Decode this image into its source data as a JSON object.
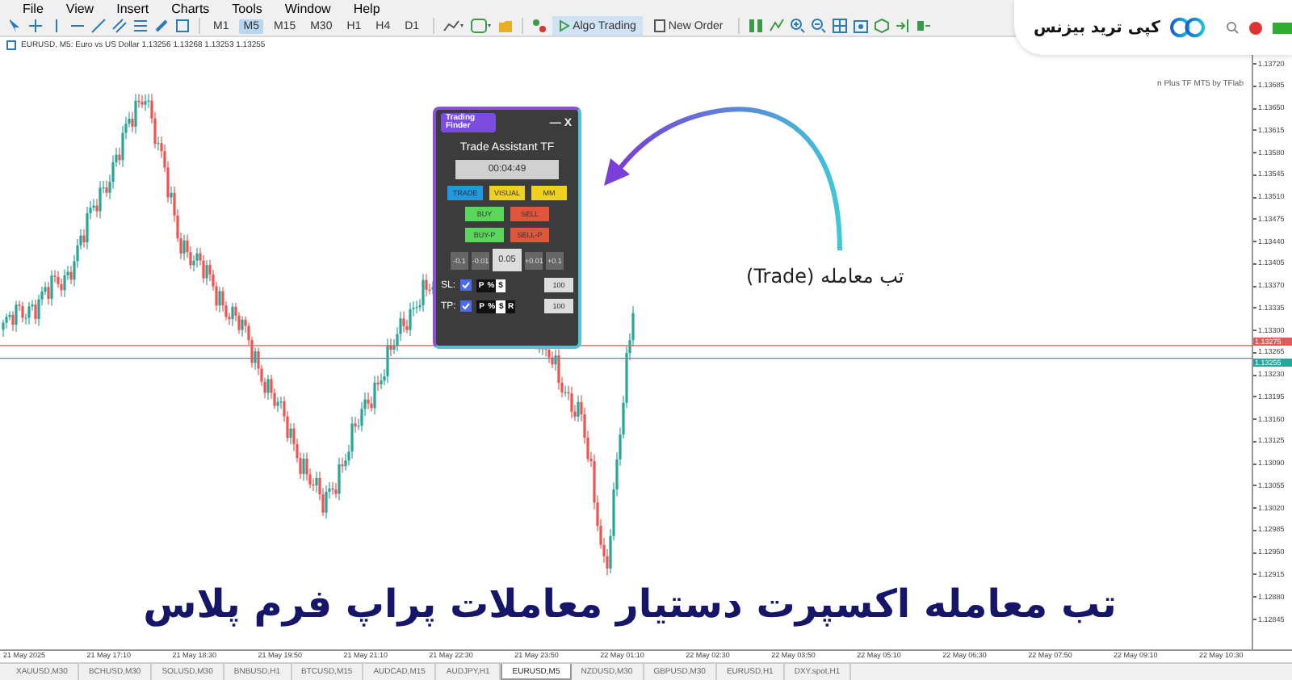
{
  "menu": [
    {
      "label": "File"
    },
    {
      "label": "View"
    },
    {
      "label": "Insert"
    },
    {
      "label": "Charts"
    },
    {
      "label": "Tools"
    },
    {
      "label": "Window"
    },
    {
      "label": "Help"
    }
  ],
  "timeframes": [
    {
      "label": "M1",
      "selected": false
    },
    {
      "label": "M5",
      "selected": true
    },
    {
      "label": "M15",
      "selected": false
    },
    {
      "label": "M30",
      "selected": false
    },
    {
      "label": "H1",
      "selected": false
    },
    {
      "label": "H4",
      "selected": false
    },
    {
      "label": "D1",
      "selected": false
    }
  ],
  "toolbar_buttons": [
    {
      "label": "Algo Trading",
      "selected": true
    },
    {
      "label": "New Order",
      "selected": false
    }
  ],
  "brand": {
    "name": "کپی ترید بیزنس"
  },
  "chart": {
    "header": "EURUSD, M5:  Euro vs US Dollar  1.13256  1.13268  1.13253  1.13255",
    "indicator_label": "n Plus TF MT5 by TFlab",
    "price_labels": [
      "1.13720",
      "1.13685",
      "1.13650",
      "1.13615",
      "1.13580",
      "1.13545",
      "1.13510",
      "1.13475",
      "1.13440",
      "1.13405",
      "1.13370",
      "1.13335",
      "1.13300",
      "1.13265",
      "1.13230",
      "1.13195",
      "1.13160",
      "1.13125",
      "1.13090",
      "1.13055",
      "1.13020",
      "1.12985",
      "1.12950",
      "1.12915",
      "1.12880",
      "1.12845"
    ],
    "price_lines": [
      {
        "price": "1.13275",
        "color": "#e05a5a"
      },
      {
        "price": "1.13255",
        "color": "#26a69a"
      }
    ],
    "time_labels": [
      "21 May 2025",
      "21 May 17:10",
      "21 May 18:30",
      "21 May 19:50",
      "21 May 21:10",
      "21 May 22:30",
      "21 May 23:50",
      "22 May 01:10",
      "22 May 02:30",
      "22 May 03:50",
      "22 May 05:10",
      "22 May 06:30",
      "22 May 07:50",
      "22 May 09:10",
      "22 May 10:30"
    ]
  },
  "panel": {
    "logo": "Trading Finder",
    "minimize": "—",
    "close": "X",
    "title": "Trade Assistant TF",
    "timer": "00:04:49",
    "modes": [
      {
        "label": "TRADE",
        "selected": true
      },
      {
        "label": "VISUAL",
        "selected": false
      },
      {
        "label": "MM",
        "selected": false
      }
    ],
    "orders": [
      {
        "label": "BUY",
        "kind": "buy"
      },
      {
        "label": "SELL",
        "kind": "sell"
      },
      {
        "label": "BUY-P",
        "kind": "buy"
      },
      {
        "label": "SELL-P",
        "kind": "sell"
      }
    ],
    "lot_steps": [
      {
        "label": "-0.1",
        "kind": "step"
      },
      {
        "label": "-0.01",
        "kind": "step"
      },
      {
        "label": "0.05",
        "kind": "value"
      },
      {
        "label": "+0.01",
        "kind": "step"
      },
      {
        "label": "+0.1",
        "kind": "step"
      }
    ],
    "stops": [
      {
        "label": "SL:",
        "checked": true,
        "units": [
          {
            "label": "P",
            "selected": false
          },
          {
            "label": "%",
            "selected": false
          },
          {
            "label": "$",
            "selected": true
          }
        ],
        "value": "100"
      },
      {
        "label": "TP:",
        "checked": true,
        "units": [
          {
            "label": "P",
            "selected": false
          },
          {
            "label": "%",
            "selected": false
          },
          {
            "label": "$",
            "selected": true
          },
          {
            "label": "R",
            "selected": false
          }
        ],
        "value": "100"
      }
    ]
  },
  "annotation": "تب معامله (Trade)",
  "banner": "تب معامله اکسپرت دستیار معاملات پراپ فرم پلاس",
  "symbol_tabs": [
    {
      "label": "XAUUSD,M30",
      "selected": false
    },
    {
      "label": "BCHUSD,M30",
      "selected": false
    },
    {
      "label": "SOLUSD,M30",
      "selected": false
    },
    {
      "label": "BNBUSD,H1",
      "selected": false
    },
    {
      "label": "BTCUSD,M15",
      "selected": false
    },
    {
      "label": "AUDCAD,M15",
      "selected": false
    },
    {
      "label": "AUDJPY,H1",
      "selected": false
    },
    {
      "label": "EURUSD,M5",
      "selected": true
    },
    {
      "label": "NZDUSD,M30",
      "selected": false
    },
    {
      "label": "GBPUSD,M30",
      "selected": false
    },
    {
      "label": "EURUSD,H1",
      "selected": false
    },
    {
      "label": "DXY.spot,H1",
      "selected": false
    }
  ]
}
